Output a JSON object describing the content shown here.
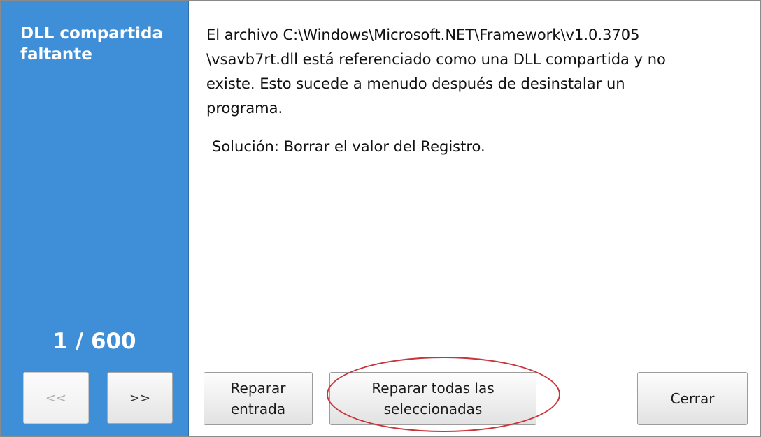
{
  "sidebar": {
    "title": "DLL compartida faltante",
    "counter": "1 / 600",
    "prev_label": "<<",
    "next_label": ">>"
  },
  "content": {
    "message_line1": "El archivo C:\\Windows\\Microsoft.NET\\Framework\\v1.0.3705",
    "message_line2": "\\vsavb7rt.dll está referenciado como una DLL compartida y no",
    "message_line3": "existe. Esto sucede a menudo después de desinstalar un",
    "message_line4": "programa.",
    "solution": "Solución: Borrar el valor del Registro."
  },
  "buttons": {
    "repair_line1": "Reparar",
    "repair_line2": "entrada",
    "repair_all_line1": "Reparar todas las",
    "repair_all_line2": "seleccionadas",
    "close": "Cerrar"
  },
  "colors": {
    "sidebar": "#3f8fd8",
    "highlight": "#c8343a"
  }
}
